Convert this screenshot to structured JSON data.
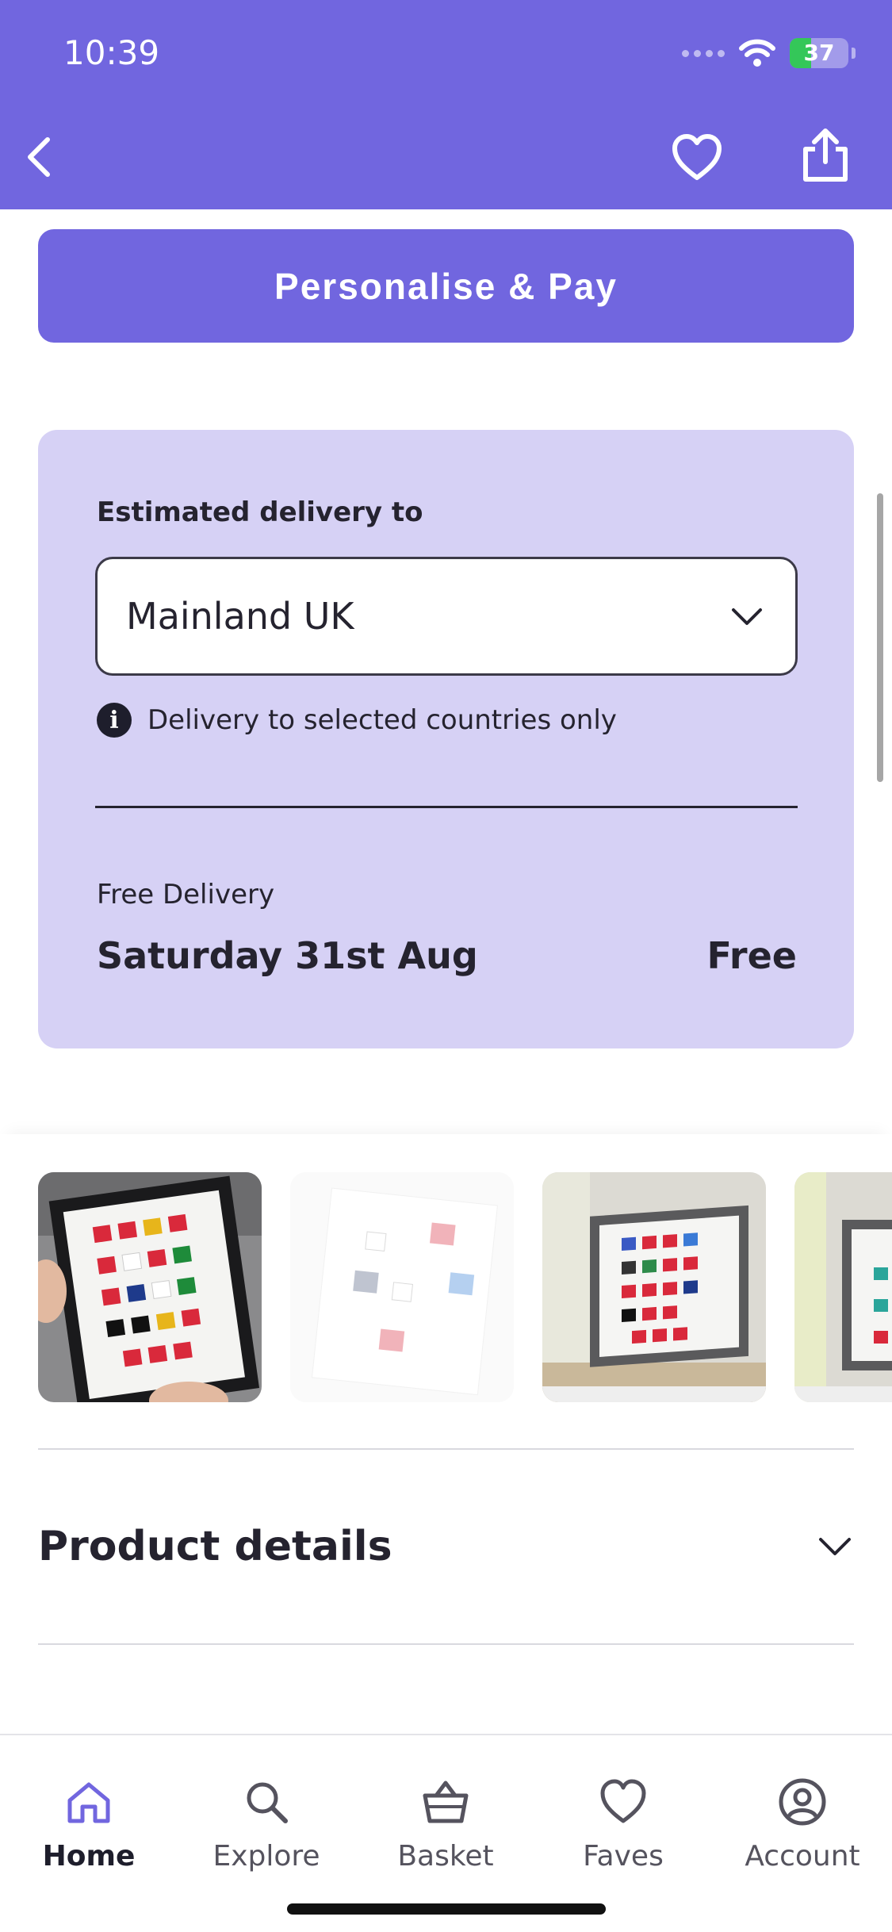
{
  "status_bar": {
    "time": "10:39",
    "battery_percent": "37",
    "battery_level": 0.37
  },
  "header": {
    "back_icon": "chevron-left-icon",
    "favourite_icon": "heart-icon",
    "share_icon": "share-icon"
  },
  "actions": {
    "personalise_pay_label": "Personalise & Pay"
  },
  "delivery": {
    "estimate_label": "Estimated delivery to",
    "selected_region": "Mainland UK",
    "info_note": "Delivery to selected countries only",
    "option_label": "Free Delivery",
    "date": "Saturday 31st Aug",
    "price": "Free"
  },
  "gallery": {
    "selected_index": 0,
    "thumbnails": [
      "framed-print-held",
      "framed-print-light",
      "framed-print-on-shelf",
      "framed-print-partial"
    ]
  },
  "sections": {
    "product_details_label": "Product details"
  },
  "tabbar": {
    "items": [
      {
        "label": "Home",
        "icon": "home-icon",
        "active": true
      },
      {
        "label": "Explore",
        "icon": "search-icon",
        "active": false
      },
      {
        "label": "Basket",
        "icon": "basket-icon",
        "active": false
      },
      {
        "label": "Faves",
        "icon": "heart-icon",
        "active": false
      },
      {
        "label": "Account",
        "icon": "account-icon",
        "active": false
      }
    ]
  },
  "colors": {
    "brand": "#7166df",
    "card_background": "#d6d1f5"
  }
}
